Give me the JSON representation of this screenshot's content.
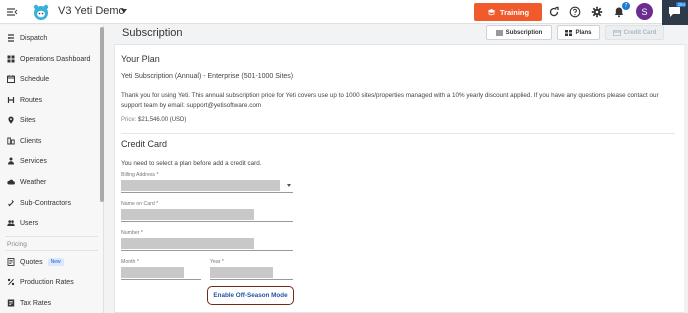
{
  "app": {
    "title": "V3 Yeti Demo"
  },
  "topbar": {
    "training_label": "Training",
    "notification_count": "7",
    "avatar_initial": "S",
    "chat_count": "294",
    "icons": [
      "menu-collapse-icon",
      "yeti-logo-icon",
      "graduation-cap-icon",
      "refresh-icon",
      "help-icon",
      "gear-icon",
      "bell-icon",
      "chat-icon"
    ],
    "accent_color": "#f15a2a"
  },
  "sidebar": {
    "items": [
      {
        "label": "Dispatch",
        "icon": "dispatch-icon"
      },
      {
        "label": "Operations Dashboard",
        "icon": "dashboard-icon"
      },
      {
        "label": "Schedule",
        "icon": "calendar-icon"
      },
      {
        "label": "Routes",
        "icon": "routes-icon"
      },
      {
        "label": "Sites",
        "icon": "map-pin-icon"
      },
      {
        "label": "Clients",
        "icon": "clients-icon"
      },
      {
        "label": "Services",
        "icon": "services-icon"
      },
      {
        "label": "Weather",
        "icon": "cloud-icon"
      },
      {
        "label": "Sub-Contractors",
        "icon": "sub-contractors-icon"
      },
      {
        "label": "Users",
        "icon": "users-icon"
      }
    ],
    "pricing_section": "Pricing",
    "pricing_items": [
      {
        "label": "Quotes",
        "badge": "New",
        "icon": "quotes-icon"
      },
      {
        "label": "Production Rates",
        "icon": "percent-icon"
      },
      {
        "label": "Tax Rates",
        "icon": "tax-icon"
      }
    ]
  },
  "header": {
    "title": "Subscription",
    "buttons": [
      {
        "label": "Subscription",
        "icon": "list-icon"
      },
      {
        "label": "Plans",
        "icon": "grid-icon"
      },
      {
        "label": "Credit Card",
        "icon": "credit-card-icon",
        "disabled": true
      }
    ]
  },
  "plan": {
    "section_title": "Your Plan",
    "name": "Yeti Subscription (Annual) - Enterprise (501-1000 Sites)",
    "description": "Thank you for using Yeti. This annual subscription price for Yeti covers use up to 1000 sites/properties managed with a 10% yearly discount applied. If you have any questions please contact our support team by email: support@yetisoftware.com",
    "price_label": "Price:",
    "price_value": "$21,546.00 (USD)"
  },
  "credit_card": {
    "section_title": "Credit Card",
    "note": "You need to select a plan before add a credit card.",
    "fields": {
      "billing_address": "Billing Address *",
      "name_on_card": "Name on Card *",
      "number": "Number *",
      "month": "Month *",
      "year": "Year *"
    },
    "offseason_button": "Enable Off-Season Mode"
  }
}
